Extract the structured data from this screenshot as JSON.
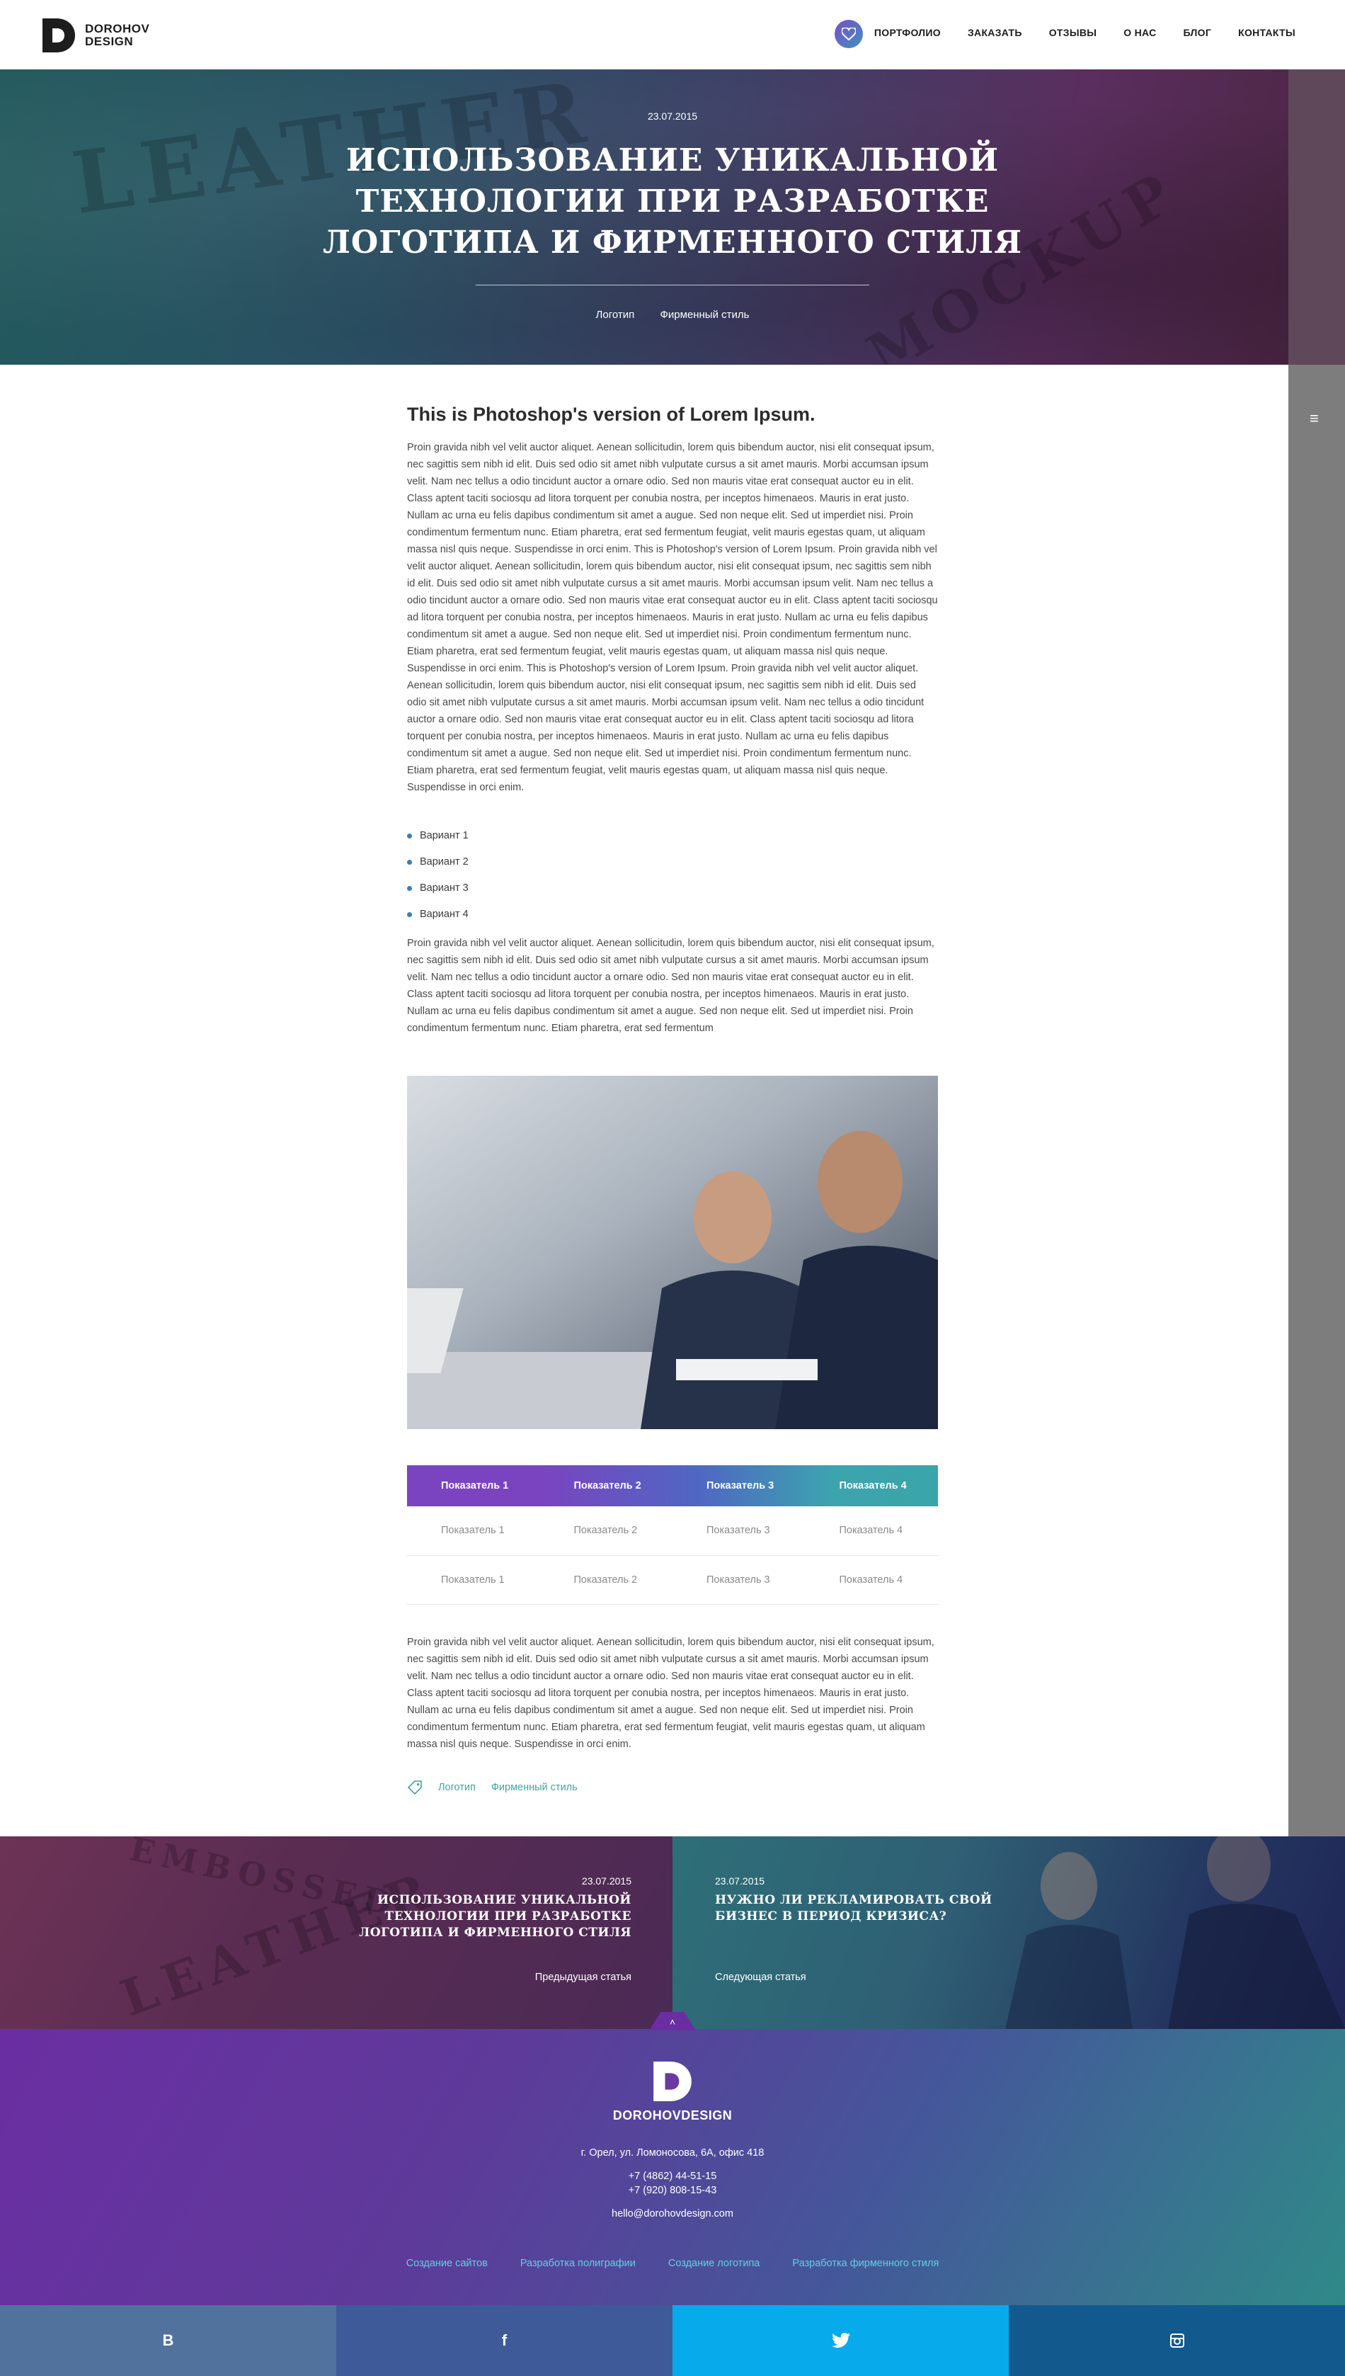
{
  "brand": {
    "line1": "DOROHOV",
    "line2": "DESIGN"
  },
  "nav": [
    "ПОРТФОЛИО",
    "ЗАКАЗАТЬ",
    "ОТЗЫВЫ",
    "О НАС",
    "БЛОГ",
    "КОНТАКТЫ"
  ],
  "hero": {
    "date": "23.07.2015",
    "title": "ИСПОЛЬЗОВАНИЕ УНИКАЛЬНОЙ ТЕХНОЛОГИИ ПРИ РАЗРАБОТКЕ ЛОГОТИПА И ФИРМЕННОГО СТИЛЯ",
    "tags": [
      "Логотип",
      "Фирменный стиль"
    ]
  },
  "article": {
    "heading": "This is Photoshop's version  of Lorem Ipsum.",
    "p1": "Proin gravida nibh vel velit auctor aliquet. Aenean sollicitudin, lorem quis bibendum auctor, nisi elit consequat ipsum, nec sagittis sem nibh id elit. Duis sed odio sit amet nibh vulputate cursus a sit amet mauris. Morbi accumsan ipsum velit. Nam nec tellus a odio tincidunt auctor a ornare odio. Sed non  mauris vitae erat consequat auctor eu in elit. Class aptent taciti sociosqu ad litora torquent per conubia nostra, per inceptos himenaeos. Mauris in erat justo. Nullam ac urna eu felis dapibus condimentum sit amet a augue. Sed non neque elit. Sed ut imperdiet nisi. Proin condimentum fermentum nunc. Etiam pharetra, erat sed fermentum feugiat, velit mauris egestas quam, ut aliquam massa nisl quis neque. Suspendisse in orci enim. This is Photoshop's version  of Lorem Ipsum. Proin gravida nibh vel velit auctor aliquet. Aenean sollicitudin, lorem quis bibendum auctor, nisi elit consequat ipsum, nec sagittis sem nibh id elit. Duis sed odio sit amet nibh vulputate cursus a sit amet mauris. Morbi accumsan ipsum velit. Nam nec tellus a odio tincidunt auctor a ornare odio. Sed non  mauris vitae erat consequat auctor eu in elit. Class aptent taciti sociosqu ad litora torquent per conubia nostra, per inceptos himenaeos. Mauris in erat justo. Nullam ac urna eu felis dapibus condimentum sit amet a augue. Sed non neque elit. Sed ut imperdiet nisi. Proin condimentum fermentum nunc. Etiam pharetra, erat sed fermentum feugiat, velit mauris egestas quam, ut aliquam massa nisl quis neque. Suspendisse in orci enim. This is Photoshop's version  of Lorem Ipsum. Proin gravida nibh vel velit auctor aliquet. Aenean sollicitudin, lorem quis bibendum auctor, nisi elit consequat ipsum, nec sagittis sem nibh id elit. Duis sed odio sit amet nibh vulputate cursus a sit amet mauris. Morbi accumsan ipsum velit. Nam nec tellus a odio tincidunt auctor a ornare odio. Sed non  mauris vitae erat consequat auctor eu in elit. Class aptent taciti sociosqu ad litora torquent per conubia nostra, per inceptos himenaeos. Mauris in erat justo. Nullam ac urna eu felis dapibus condimentum sit amet a augue. Sed non neque elit. Sed ut imperdiet nisi. Proin condimentum fermentum nunc. Etiam pharetra, erat sed fermentum feugiat, velit mauris egestas quam, ut aliquam massa nisl quis neque. Suspendisse in orci enim.",
    "list": [
      "Вариант 1",
      "Вариант 2",
      "Вариант 3",
      "Вариант 4"
    ],
    "p2": "Proin gravida nibh vel velit auctor aliquet. Aenean sollicitudin, lorem quis bibendum auctor, nisi elit consequat ipsum, nec sagittis sem nibh id elit. Duis sed odio sit amet nibh vulputate cursus a sit amet mauris. Morbi accumsan ipsum velit. Nam nec tellus a odio tincidunt auctor a ornare odio. Sed non  mauris vitae erat consequat auctor eu in elit. Class aptent taciti sociosqu ad litora torquent per conubia nostra, per inceptos himenaeos. Mauris in erat justo. Nullam ac urna eu felis dapibus condimentum sit amet a augue. Sed non neque elit. Sed ut imperdiet nisi. Proin condimentum fermentum nunc. Etiam pharetra, erat sed fermentum",
    "table": {
      "headers": [
        "Показатель 1",
        "Показатель 2",
        "Показатель 3",
        "Показатель 4"
      ],
      "rows": [
        [
          "Показатель 1",
          "Показатель 2",
          "Показатель 3",
          "Показатель 4"
        ],
        [
          "Показатель 1",
          "Показатель 2",
          "Показатель 3",
          "Показатель 4"
        ]
      ]
    },
    "p3": "Proin gravida nibh vel velit auctor aliquet. Aenean sollicitudin, lorem quis bibendum auctor, nisi elit consequat ipsum, nec sagittis sem nibh id elit. Duis sed odio sit amet nibh vulputate cursus a sit amet mauris. Morbi accumsan ipsum velit. Nam nec tellus a odio tincidunt auctor a ornare odio. Sed non  mauris vitae erat consequat auctor eu in elit. Class aptent taciti sociosqu ad litora torquent per conubia nostra, per inceptos himenaeos. Mauris in erat justo. Nullam ac urna eu felis dapibus condimentum sit amet a augue. Sed non neque elit. Sed ut imperdiet nisi. Proin condimentum fermentum nunc. Etiam pharetra, erat sed fermentum feugiat, velit mauris egestas quam, ut aliquam massa nisl quis neque. Suspendisse in orci enim.",
    "tags": [
      "Логотип",
      "Фирменный стиль"
    ]
  },
  "prev": {
    "date": "23.07.2015",
    "title": "ИСПОЛЬЗОВАНИЕ УНИКАЛЬНОЙ ТЕХНОЛОГИИ ПРИ РАЗРАБОТКЕ ЛОГОТИПА И ФИРМЕННОГО СТИЛЯ",
    "link": "Предыдущая статья"
  },
  "next": {
    "date": "23.07.2015",
    "title": "НУЖНО ЛИ РЕКЛАМИРОВАТЬ СВОЙ БИЗНЕС В ПЕРИОД КРИЗИСА?",
    "link": "Следующая статья"
  },
  "footer": {
    "brand": "DOROHOVDESIGN",
    "address": "г. Орел, ул. Ломоносова, 6А, офис 418",
    "phone1": "+7 (4862) 44-51-15",
    "phone2": "+7 (920) 808-15-43",
    "email": "hello@dorohovdesign.com",
    "links": [
      "Создание сайтов",
      "Разработка полиграфии",
      "Создание логотипа",
      "Разработка фирменного стиля"
    ]
  },
  "social": {
    "vk": "B",
    "fb": "f",
    "tw": "twitter-icon",
    "ig": "instagram-icon"
  },
  "colors": {
    "accent_purple": "#7a44c0",
    "accent_teal": "#3aa6a3",
    "list_bullet": "#3b7fb8"
  }
}
